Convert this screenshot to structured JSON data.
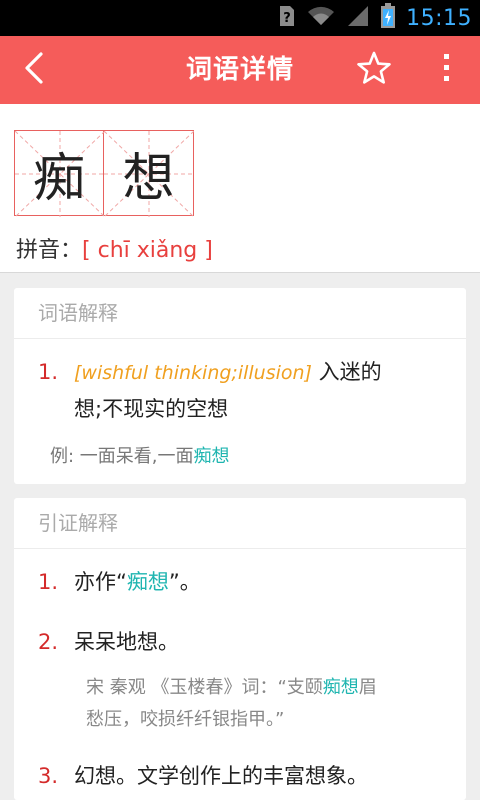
{
  "status_bar": {
    "time": "15:15"
  },
  "app_bar": {
    "title": "词语详情"
  },
  "word": {
    "chars": [
      "痴",
      "想"
    ],
    "pinyin_label": "拼音：",
    "pinyin_value": "[ chī xiǎng ]"
  },
  "definitions": {
    "title": "词语解释",
    "items": [
      {
        "num": "1.",
        "english": "[wishful thinking;illusion]",
        "text_line1": "入迷的",
        "text_line2": "想;不现实的空想"
      }
    ],
    "example_prefix": "例: 一面呆看,一面",
    "example_link": "痴想"
  },
  "citations": {
    "title": "引证解释",
    "items": [
      {
        "num": "1.",
        "pre": "亦作“",
        "link": "痴想",
        "post": "”。"
      },
      {
        "num": "2.",
        "text": "呆呆地想。",
        "quote_line1_pre": "宋 秦观 《玉楼春》词：“支颐",
        "quote_line1_link": "痴想",
        "quote_line1_post": "眉",
        "quote_line2": "愁压，咬损纤纤银指甲。”"
      },
      {
        "num": "3.",
        "text": "幻想。文学创作上的丰富想象。"
      }
    ]
  },
  "colors": {
    "accent": "#f55c5a",
    "number_red": "#d42a2a",
    "english_orange": "#f0a020",
    "link_teal": "#1fb5b0"
  },
  "icons": {
    "back": "chevron-left-icon",
    "star": "star-outline-icon",
    "more": "more-vertical-icon",
    "wifi": "wifi-icon",
    "signal": "signal-icon",
    "battery": "battery-icon",
    "sim": "sim-unknown-icon"
  }
}
